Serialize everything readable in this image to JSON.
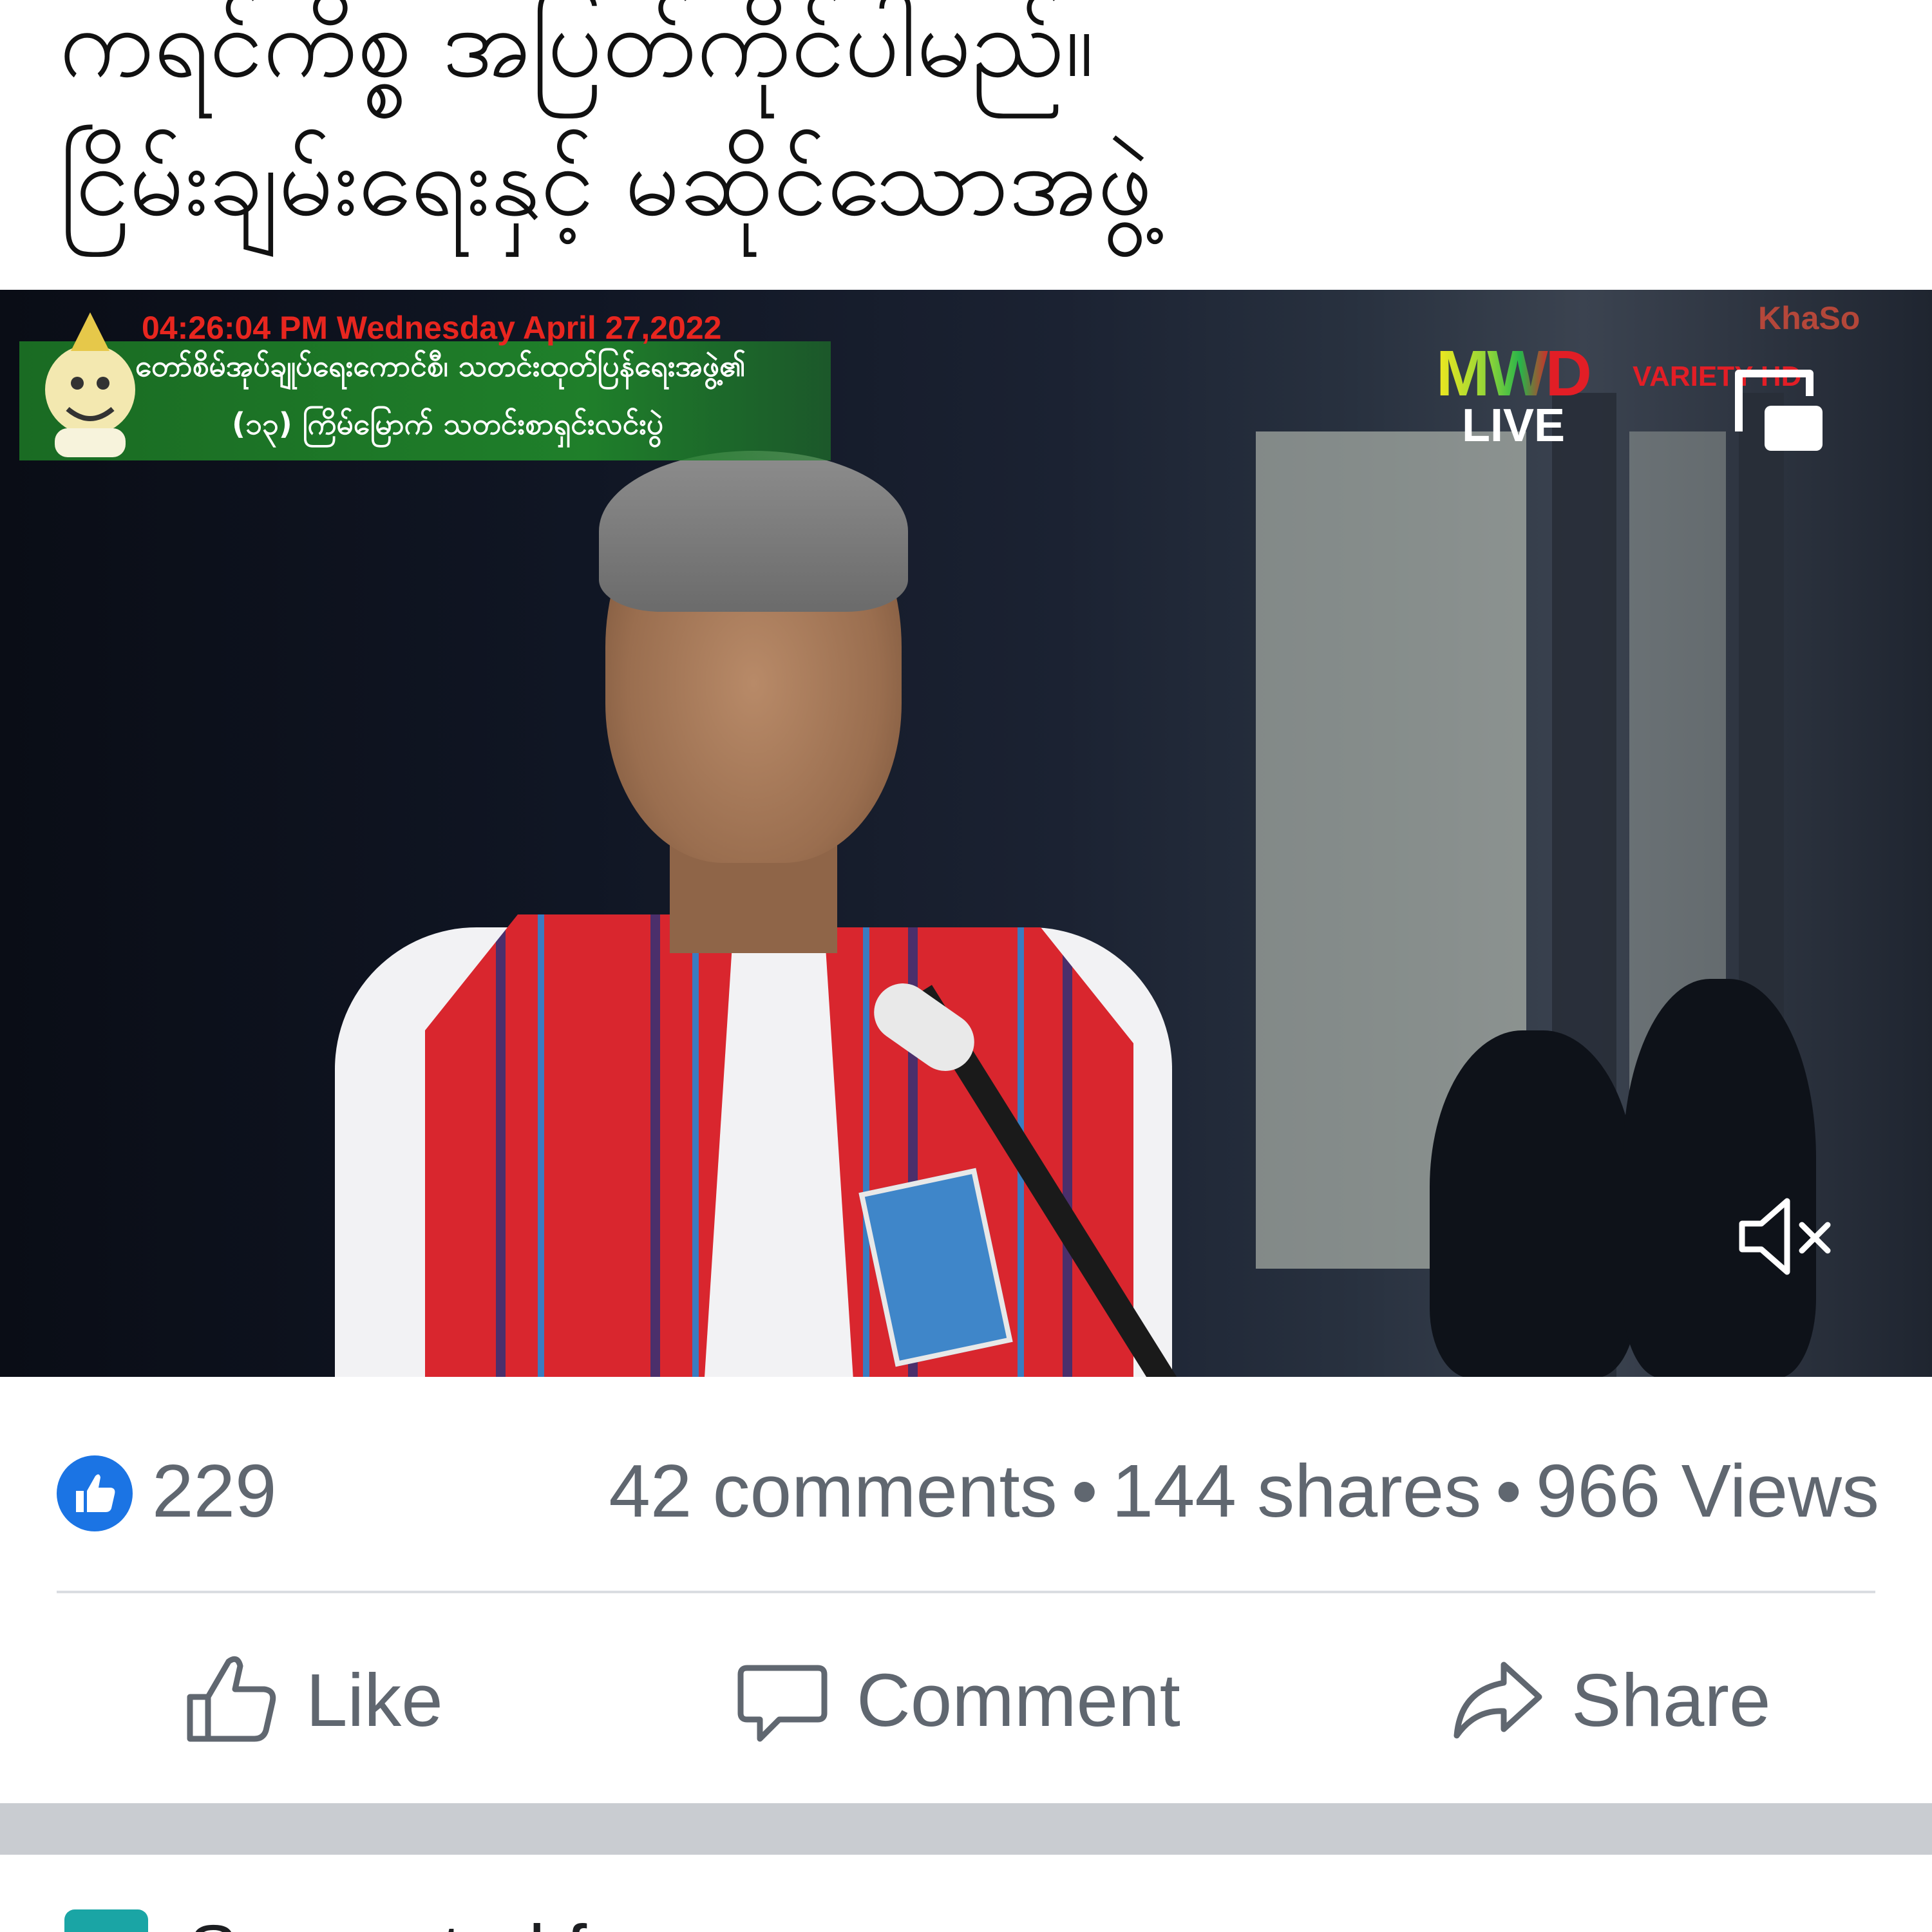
{
  "post": {
    "caption_lines": [
      "ကရင်ကိစ္စ အပြတ်ကိုင်ပါမည်။",
      "ငြိမ်းချမ်းရေးနှင့် မဆိုင်သောအဖွဲ့"
    ]
  },
  "video": {
    "overlay_time": "04:26:04 PM   Wednesday April 27,2022",
    "banner_line_1": "တော်စိမ်အုပ်ချုပ်ရေးကောင်စီ၊ သတင်းထုတ်ပြန်ရေးအဖွဲ့၏",
    "banner_line_2": "(၁၃) ကြိမ်မြောက် သတင်းစာရှင်းလင်းပွဲ",
    "logo_mwd": "MWD",
    "logo_live": "LIVE",
    "logo_variety": "VARIETY HD",
    "corner_watermark": "KhaSo",
    "icons": {
      "pip": "picture-in-picture-icon",
      "mute": "mute-icon"
    }
  },
  "stats": {
    "like_count": "229",
    "comments": "42 comments",
    "shares": "144 shares",
    "views": "966 Views",
    "separator": "•"
  },
  "actions": {
    "like_label": "Like",
    "comment_label": "Comment",
    "share_label": "Share"
  },
  "suggested": {
    "label": "Suggested for you"
  },
  "colors": {
    "like_blue": "#1b74e4",
    "meta_gray": "#606770",
    "divider": "#dadde1",
    "band_gray": "#c9ccd1",
    "banner_green": "#1f7f2a",
    "overlay_red": "#e8261f"
  }
}
